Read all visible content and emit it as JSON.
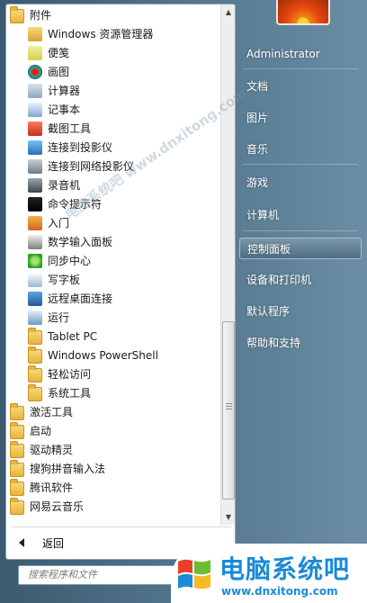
{
  "left_panel": {
    "items": [
      {
        "label": "附件",
        "icon": "folder-icon",
        "level": 0
      },
      {
        "label": "Windows 资源管理器",
        "icon": "explorer-icon",
        "level": 1
      },
      {
        "label": "便笺",
        "icon": "sticky-notes-icon",
        "level": 1
      },
      {
        "label": "画图",
        "icon": "paint-icon",
        "level": 1
      },
      {
        "label": "计算器",
        "icon": "calculator-icon",
        "level": 1
      },
      {
        "label": "记事本",
        "icon": "notepad-icon",
        "level": 1
      },
      {
        "label": "截图工具",
        "icon": "snipping-tool-icon",
        "level": 1
      },
      {
        "label": "连接到投影仪",
        "icon": "projector-icon",
        "level": 1
      },
      {
        "label": "连接到网络投影仪",
        "icon": "network-projector-icon",
        "level": 1
      },
      {
        "label": "录音机",
        "icon": "microphone-icon",
        "level": 1
      },
      {
        "label": "命令提示符",
        "icon": "cmd-icon",
        "level": 1
      },
      {
        "label": "入门",
        "icon": "getting-started-icon",
        "level": 1
      },
      {
        "label": "数学输入面板",
        "icon": "math-input-icon",
        "level": 1
      },
      {
        "label": "同步中心",
        "icon": "sync-icon",
        "level": 1
      },
      {
        "label": "写字板",
        "icon": "wordpad-icon",
        "level": 1
      },
      {
        "label": "远程桌面连接",
        "icon": "remote-desktop-icon",
        "level": 1
      },
      {
        "label": "运行",
        "icon": "run-icon",
        "level": 1
      },
      {
        "label": "Tablet PC",
        "icon": "folder-icon",
        "level": 1
      },
      {
        "label": "Windows PowerShell",
        "icon": "folder-icon",
        "level": 1
      },
      {
        "label": "轻松访问",
        "icon": "folder-icon",
        "level": 1
      },
      {
        "label": "系统工具",
        "icon": "folder-icon",
        "level": 1
      },
      {
        "label": "激活工具",
        "icon": "folder-icon",
        "level": 0
      },
      {
        "label": "启动",
        "icon": "folder-icon",
        "level": 0
      },
      {
        "label": "驱动精灵",
        "icon": "folder-icon",
        "level": 0
      },
      {
        "label": "搜狗拼音输入法",
        "icon": "folder-icon",
        "level": 0
      },
      {
        "label": "腾讯软件",
        "icon": "folder-icon",
        "level": 0
      },
      {
        "label": "网易云音乐",
        "icon": "folder-icon",
        "level": 0
      }
    ],
    "back_label": "返回",
    "search_placeholder": "搜索程序和文件"
  },
  "right_panel": {
    "items": [
      {
        "label": "Administrator"
      },
      {
        "label": "文档"
      },
      {
        "label": "图片"
      },
      {
        "label": "音乐"
      },
      {
        "label": "游戏"
      },
      {
        "label": "计算机"
      },
      {
        "label": "控制面板",
        "active": true
      },
      {
        "label": "设备和打印机"
      },
      {
        "label": "默认程序"
      },
      {
        "label": "帮助和支持"
      }
    ]
  },
  "watermark": {
    "brand_name": "电脑系统吧",
    "brand_url": "www.dnxitong.com",
    "overlay_text": "电脑系统吧 www.dnxitong.com"
  },
  "colors": {
    "accent": "#1a8ad8",
    "folder": "#e9b338",
    "frame": "#55788e"
  }
}
